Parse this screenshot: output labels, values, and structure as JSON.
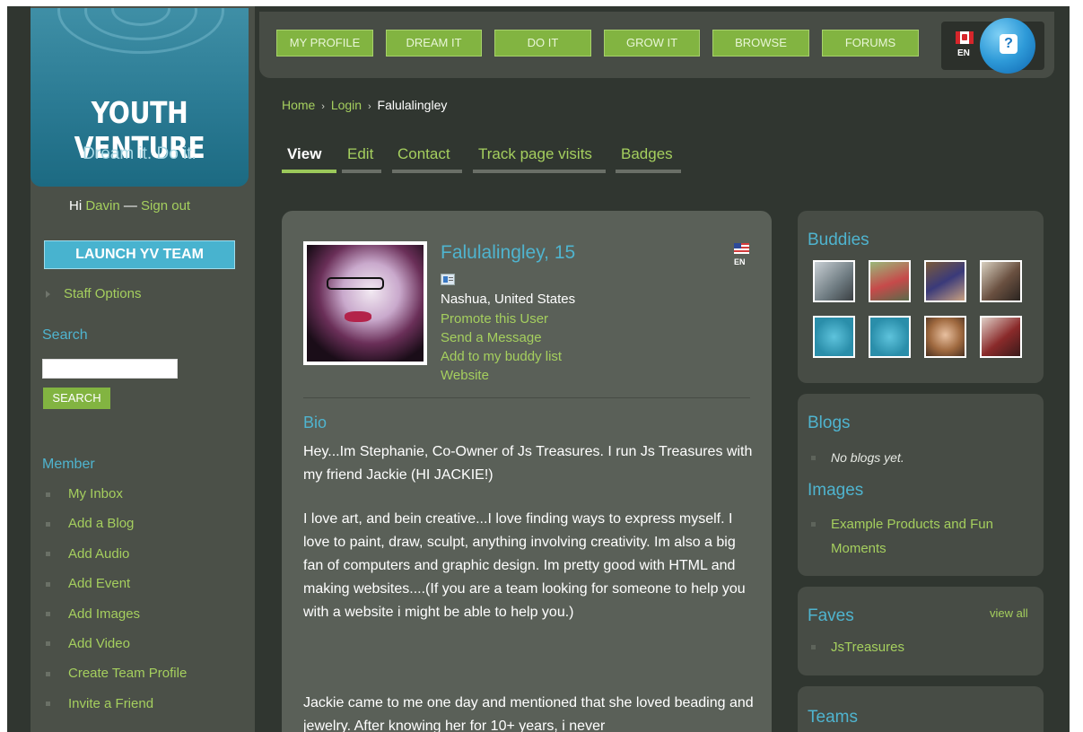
{
  "logo": {
    "title": "YOUTH VENTURE",
    "tagline": "Dream it. Do it."
  },
  "user": {
    "hi": "Hi",
    "name": "Davin",
    "dash": "—",
    "signout": "Sign out"
  },
  "sidebar": {
    "launch_button": "LAUNCH YV TEAM",
    "staff_options": "Staff Options",
    "search_heading": "Search",
    "search_value": "",
    "search_button": "SEARCH",
    "member_heading": "Member",
    "member_items": [
      "My Inbox",
      "Add a Blog",
      "Add Audio",
      "Add Event",
      "Add Images",
      "Add Video",
      "Create Team Profile",
      "Invite a Friend"
    ]
  },
  "nav": [
    "MY PROFILE",
    "DREAM IT",
    "DO IT",
    "GROW IT",
    "BROWSE",
    "FORUMS"
  ],
  "language": {
    "code": "EN",
    "help": "?"
  },
  "breadcrumb": {
    "home": "Home",
    "login": "Login",
    "current": "Falulalingley",
    "sep": "›"
  },
  "tabs": [
    "View",
    "Edit",
    "Contact",
    "Track page visits",
    "Badges"
  ],
  "profile": {
    "name": "Falulalingley, 15",
    "location": "Nashua, United States",
    "links": [
      "Promote this User",
      "Send a Message",
      "Add to my buddy list",
      "Website"
    ],
    "lang": "EN",
    "bio_title": "Bio",
    "bio": [
      "Hey...Im Stephanie, Co-Owner of Js Treasures. I run Js Treasures with my friend Jackie (HI JACKIE!)",
      "I love art, and bein creative...I love finding ways to express myself. I love to paint, draw, sculpt, anything involving creativity. Im also a big fan of computers and graphic design. Im pretty good with HTML and making websites....(If you are a team looking for someone to help you with a website i might be able to help you.)",
      "Jackie came to me one day and mentioned that she loved beading and jewelry. After knowing her for 10+ years, i never"
    ]
  },
  "right": {
    "buddies_title": "Buddies",
    "blogs_title": "Blogs",
    "no_blogs": "No blogs yet.",
    "images_title": "Images",
    "images_item": "Example Products and Fun Moments",
    "faves_title": "Faves",
    "view_all": "view all",
    "faves_item": "JsTreasures",
    "teams_title": "Teams"
  },
  "colors": {
    "accent_green": "#82b441",
    "link_green": "#a5cf5e",
    "heading_blue": "#4fb4cf",
    "page_bg": "#303630"
  }
}
